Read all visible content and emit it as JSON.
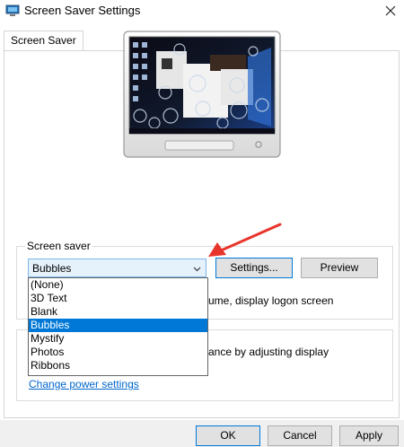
{
  "window": {
    "title": "Screen Saver Settings"
  },
  "tabs": [
    {
      "label": "Screen Saver"
    }
  ],
  "screen_saver": {
    "group_label": "Screen saver",
    "selected": "Bubbles",
    "settings_label": "Settings...",
    "preview_label": "Preview",
    "options": [
      "(None)",
      "3D Text",
      "Blank",
      "Bubbles",
      "Mystify",
      "Photos",
      "Ribbons"
    ],
    "resume_text_visible": "ume, display logon screen"
  },
  "power": {
    "text_visible": "ance by adjusting display",
    "link": "Change power settings"
  },
  "buttons": {
    "ok": "OK",
    "cancel": "Cancel",
    "apply": "Apply"
  },
  "colors": {
    "accent": "#0078d7",
    "arrow": "#e8352c",
    "link": "#0066cc"
  }
}
